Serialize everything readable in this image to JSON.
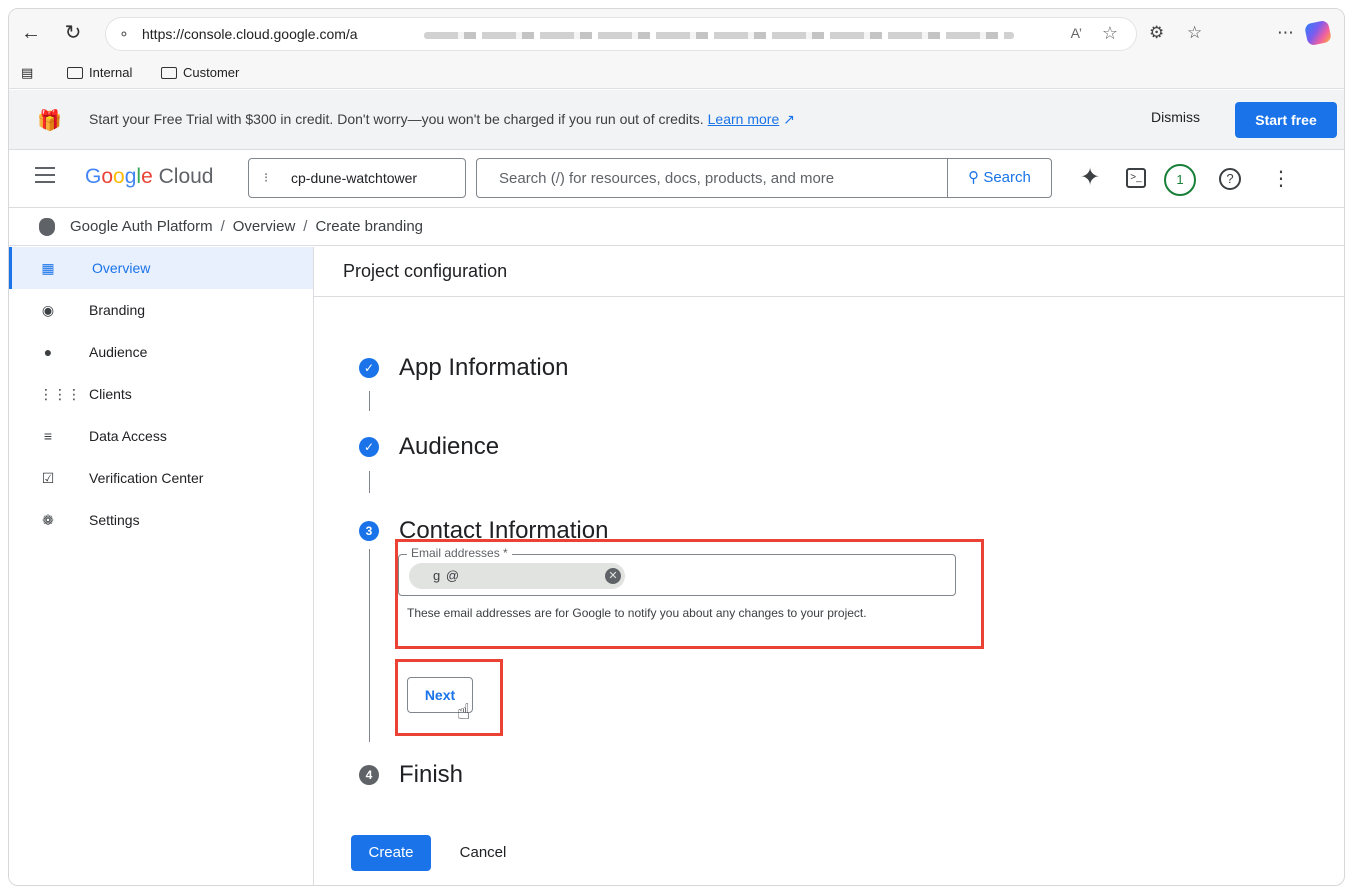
{
  "browser": {
    "url": "https://console.cloud.google.com/a",
    "bookmarks": [
      "Internal",
      "Customer"
    ],
    "icons": [
      "back-icon",
      "reload-icon",
      "lock-icon",
      "read-aloud-icon",
      "favorite-star-icon",
      "extensions-icon",
      "favorites-icon",
      "more-icon",
      "copilot-icon"
    ]
  },
  "trial_banner": {
    "message": "Start your Free Trial with $300 in credit. Don't worry—you won't be charged if you run out of credits.",
    "learn_more": "Learn more",
    "dismiss_label": "Dismiss",
    "start_label": "Start free"
  },
  "header": {
    "logo_google": "Google",
    "logo_cloud": "Cloud",
    "project_name": "cp-dune-watchtower",
    "search_placeholder": "Search (/) for resources, docs, products, and more",
    "search_label": "Search",
    "notification_count": "1"
  },
  "breadcrumb": {
    "items": [
      "Google Auth Platform",
      "Overview",
      "Create branding"
    ],
    "separator": "/"
  },
  "sidebar": {
    "items": [
      {
        "label": "Overview",
        "icon": "dashboard-icon",
        "active": true
      },
      {
        "label": "Branding",
        "icon": "palette-icon"
      },
      {
        "label": "Audience",
        "icon": "account-circle-icon"
      },
      {
        "label": "Clients",
        "icon": "grid-icon"
      },
      {
        "label": "Data Access",
        "icon": "data-access-icon"
      },
      {
        "label": "Verification Center",
        "icon": "verification-icon"
      },
      {
        "label": "Settings",
        "icon": "gear-icon"
      }
    ]
  },
  "main": {
    "title": "Project configuration",
    "steps": [
      {
        "number": "1",
        "title": "App Information",
        "status": "done"
      },
      {
        "number": "2",
        "title": "Audience",
        "status": "done"
      },
      {
        "number": "3",
        "title": "Contact Information",
        "status": "active"
      },
      {
        "number": "4",
        "title": "Finish",
        "status": "todo"
      }
    ],
    "email_field": {
      "label": "Email addresses *",
      "chip_text": "g @",
      "helper": "These email addresses are for Google to notify you about any changes to your project."
    },
    "next_label": "Next",
    "create_label": "Create",
    "cancel_label": "Cancel"
  },
  "highlight_color": "#ea4335",
  "accent_color": "#1a73e8"
}
